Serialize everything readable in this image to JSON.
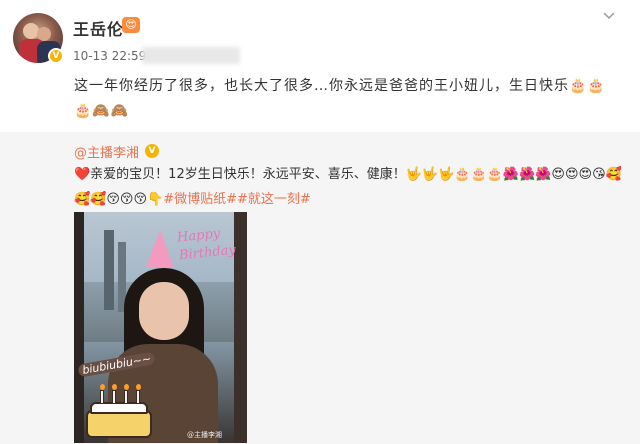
{
  "post": {
    "author": "王岳伦",
    "author_badge_icon": "smiling-face-icon",
    "timestamp": "10-13 22:59",
    "text": "这一年你经历了很多，也长大了很多…你永远是爸爸的王小妞儿，生日快乐🎂🎂🎂🙈🙈"
  },
  "repost": {
    "author": "@主播李湘",
    "text_prefix": "❤️亲爱的宝贝！12岁生日快乐！永远平安、喜乐、健康！🤟🤟🤟🎂🎂🎂🌺🌺🌺😍😍😍😘🥰🥰🥰😚😚😚👇",
    "tags": "#微博贴纸##就这一刻#",
    "image": {
      "overlay_text": "Happy Birthday",
      "sticker_text": "biubiubiu~~",
      "watermark": "@主播李湘"
    }
  },
  "colors": {
    "link": "#eb7350",
    "badge_gold": "#f6b400",
    "repost_bg": "#f5f5f5"
  }
}
